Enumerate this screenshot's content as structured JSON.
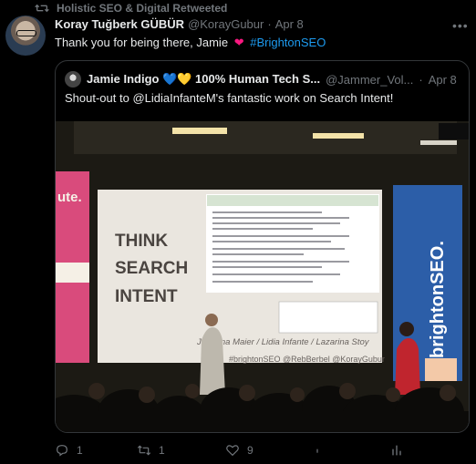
{
  "retweet_banner": {
    "text": "Holistic SEO & Digital Retweeted"
  },
  "tweet": {
    "display_name": "Koray Tuğberk GÜBÜR",
    "handle": "@KorayGubur",
    "separator": "·",
    "date": "Apr 8",
    "text_before": "Thank you for being there, Jamie",
    "emoji": "❤",
    "hashtag": "#BrightonSEO"
  },
  "quoted": {
    "display_name": "Jamie Indigo 💙💛 100% Human Tech S...",
    "handle": "@Jammer_Vol...",
    "separator": "·",
    "date": "Apr 8",
    "text": "Shout-out to @LidiaInfanteM's fantastic work on Search Intent!",
    "slide": {
      "title_lines": [
        "THINK",
        "SEARCH",
        "INTENT"
      ],
      "authors": "Johanna Maier / Lidia Infante / Lazarina Stoy",
      "handles": "#brightonSEO @RebBerbel @KorayGubur",
      "banner_right": "brightonSEO.",
      "banner_left": "ute."
    }
  },
  "actions": {
    "replies": "1",
    "retweets": "1",
    "likes": "9",
    "views": ""
  },
  "colors": {
    "accent": "#1d9bf0",
    "heart": "#f91880",
    "muted": "#71767b",
    "text": "#e7e9ea"
  },
  "icons": [
    "retweet-icon",
    "more-icon",
    "reply-icon",
    "like-icon",
    "views-icon"
  ]
}
